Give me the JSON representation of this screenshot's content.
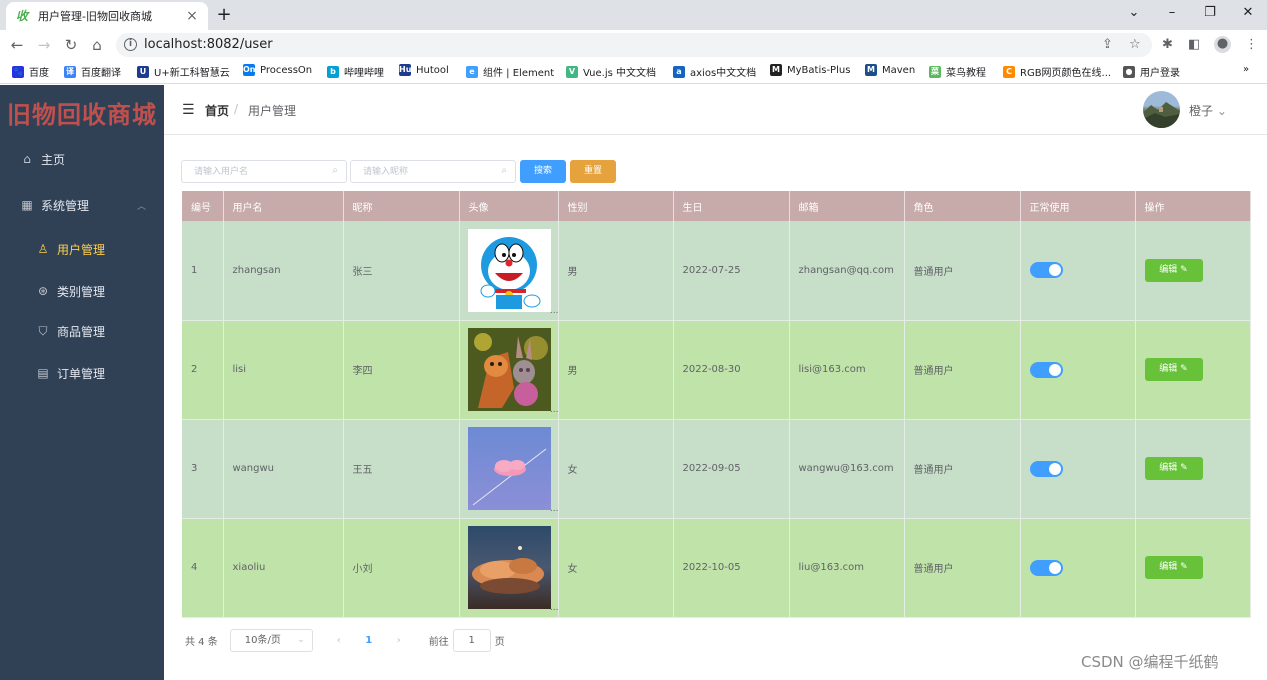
{
  "browser": {
    "tab_title": "用户管理-旧物回收商城",
    "tab_favicon": "收",
    "url": "localhost:8082/user",
    "bookmarks": [
      {
        "label": "百度",
        "color": "#2932e1",
        "icon": "🐾"
      },
      {
        "label": "百度翻译",
        "color": "#3b83f7",
        "icon": "译"
      },
      {
        "label": "U+新工科智慧云",
        "color": "#1d3b8f",
        "icon": "U"
      },
      {
        "label": "ProcessOn",
        "color": "#067bef",
        "icon": "On"
      },
      {
        "label": "哔哩哔哩",
        "color": "#00a1d6",
        "icon": "b"
      },
      {
        "label": "Hutool",
        "color": "#1d3b8f",
        "icon": "Hu"
      },
      {
        "label": "组件 | Element",
        "color": "#409eff",
        "icon": "e"
      },
      {
        "label": "Vue.js 中文文档",
        "color": "#41b883",
        "icon": "V"
      },
      {
        "label": "axios中文文档",
        "color": "#1565c0",
        "icon": "a"
      },
      {
        "label": "MyBatis-Plus",
        "color": "#222222",
        "icon": "M"
      },
      {
        "label": "Maven",
        "color": "#1a4f8b",
        "icon": "M"
      },
      {
        "label": "菜鸟教程",
        "color": "#5cb85c",
        "icon": "菜"
      },
      {
        "label": "RGB网页颜色在线...",
        "color": "#ff8a00",
        "icon": "C"
      },
      {
        "label": "用户登录",
        "color": "#555555",
        "icon": "●"
      }
    ],
    "more": "»"
  },
  "app": {
    "logo": "旧物回收商城",
    "menu": [
      {
        "label": "主页",
        "icon": "home-icon",
        "glyph": "⌂"
      },
      {
        "label": "系统管理",
        "icon": "grid-icon",
        "glyph": "▦"
      },
      {
        "label": "用户管理",
        "icon": "user-icon",
        "glyph": "♙"
      },
      {
        "label": "类别管理",
        "icon": "category-icon",
        "glyph": "⊛"
      },
      {
        "label": "商品管理",
        "icon": "bag-icon",
        "glyph": "⛉"
      },
      {
        "label": "订单管理",
        "icon": "document-icon",
        "glyph": "▤"
      }
    ],
    "header": {
      "breadcrumb_home": "首页",
      "breadcrumb_sep": "/",
      "breadcrumb_current": "用户管理",
      "user_name": "橙子",
      "user_chevron": "⌄"
    },
    "search": {
      "username_placeholder": "请输入用户名",
      "nickname_placeholder": "请输入昵称",
      "search_label": "搜索",
      "reset_label": "重置",
      "search_color": "#409eff",
      "reset_color": "#e6a23c"
    },
    "table": {
      "columns": [
        "编号",
        "用户名",
        "昵称",
        "头像",
        "性别",
        "生日",
        "邮箱",
        "角色",
        "正常使用",
        "操作"
      ],
      "rows": [
        {
          "id": "1",
          "username": "zhangsan",
          "nickname": "张三",
          "avatar": "doraemon",
          "gender": "男",
          "birthday": "2022-07-25",
          "email": "zhangsan@qq.com",
          "role": "普通用户",
          "enabled": true
        },
        {
          "id": "2",
          "username": "lisi",
          "nickname": "李四",
          "avatar": "cartoon-rabbit",
          "gender": "男",
          "birthday": "2022-08-30",
          "email": "lisi@163.com",
          "role": "普通用户",
          "enabled": true
        },
        {
          "id": "3",
          "username": "wangwu",
          "nickname": "王五",
          "avatar": "pink-cloud",
          "gender": "女",
          "birthday": "2022-09-05",
          "email": "wangwu@163.com",
          "role": "普通用户",
          "enabled": true
        },
        {
          "id": "4",
          "username": "xiaoliu",
          "nickname": "小刘",
          "avatar": "sunset-cloud",
          "gender": "女",
          "birthday": "2022-10-05",
          "email": "liu@163.com",
          "role": "普通用户",
          "enabled": true
        }
      ],
      "edit_label": "编辑 ✎",
      "header_color": "#c7aaaa",
      "row_colors": [
        "#c7dfc9",
        "#bfe3a9"
      ]
    },
    "pagination": {
      "total": "共 4 条",
      "page_size": "10条/页",
      "current_page": "1",
      "goto_label": "前往",
      "goto_value": "1",
      "page_suffix": "页"
    }
  },
  "watermark": "CSDN @编程千纸鹤"
}
